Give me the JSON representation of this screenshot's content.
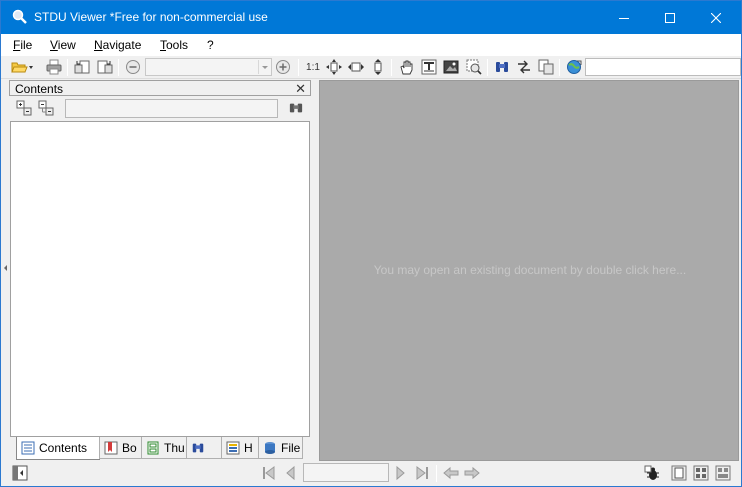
{
  "window": {
    "title": "STDU Viewer *Free for non-commercial use"
  },
  "menu": {
    "items": [
      {
        "label": "File"
      },
      {
        "label": "View"
      },
      {
        "label": "Navigate"
      },
      {
        "label": "Tools"
      },
      {
        "label": "?"
      }
    ]
  },
  "toolbar": {
    "zoom_value": "",
    "actual_size_label": "1:1",
    "search_value": ""
  },
  "left_panel": {
    "title": "Contents",
    "close_glyph": "✕",
    "search_value": "",
    "tabs": [
      {
        "label": "Contents",
        "icon": "contents-icon"
      },
      {
        "label": "Bo",
        "icon": "bookmarks-icon"
      },
      {
        "label": "Thu",
        "icon": "thumbnails-icon"
      },
      {
        "label": "",
        "icon": "search-icon"
      },
      {
        "label": "H",
        "icon": "highlights-icon"
      },
      {
        "label": "File",
        "icon": "file-properties-icon"
      }
    ]
  },
  "document": {
    "hint": "You may open an existing document by double click here..."
  },
  "statusbar": {
    "page_value": ""
  },
  "colors": {
    "titlebar": "#0078d7",
    "doc_background": "#aaaaaa",
    "hint_text": "#c7c7c7"
  }
}
